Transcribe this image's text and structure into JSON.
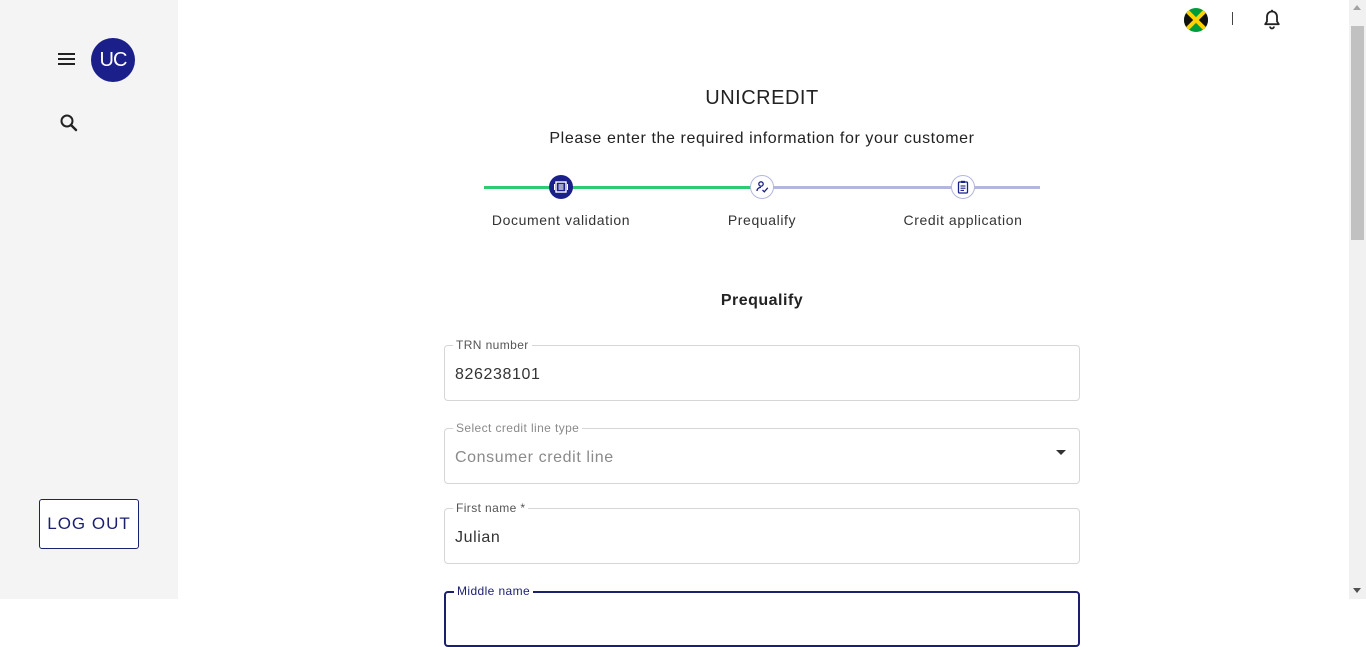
{
  "sidebar": {
    "avatar_initials": "UC",
    "logout_label": "LOG OUT"
  },
  "topbar": {
    "divider_text": "",
    "flag": "jamaica-flag"
  },
  "header": {
    "title": "UNICREDIT",
    "subtitle": "Please enter the required information for your customer"
  },
  "stepper": {
    "steps": [
      {
        "label": "Document validation",
        "state": "completed"
      },
      {
        "label": "Prequalify",
        "state": "active"
      },
      {
        "label": "Credit application",
        "state": "pending"
      }
    ]
  },
  "form": {
    "section_title": "Prequalify",
    "fields": [
      {
        "label": "TRN number",
        "value": "826238101"
      },
      {
        "label": "Select credit line type",
        "value": "Consumer credit line"
      },
      {
        "label": "First name *",
        "value": "Julian"
      },
      {
        "label": "Middle name",
        "value": ""
      }
    ]
  },
  "colors": {
    "primary": "#1a1f8a",
    "progress_done": "#2ecc71",
    "progress_pending": "#b3b6e0"
  }
}
